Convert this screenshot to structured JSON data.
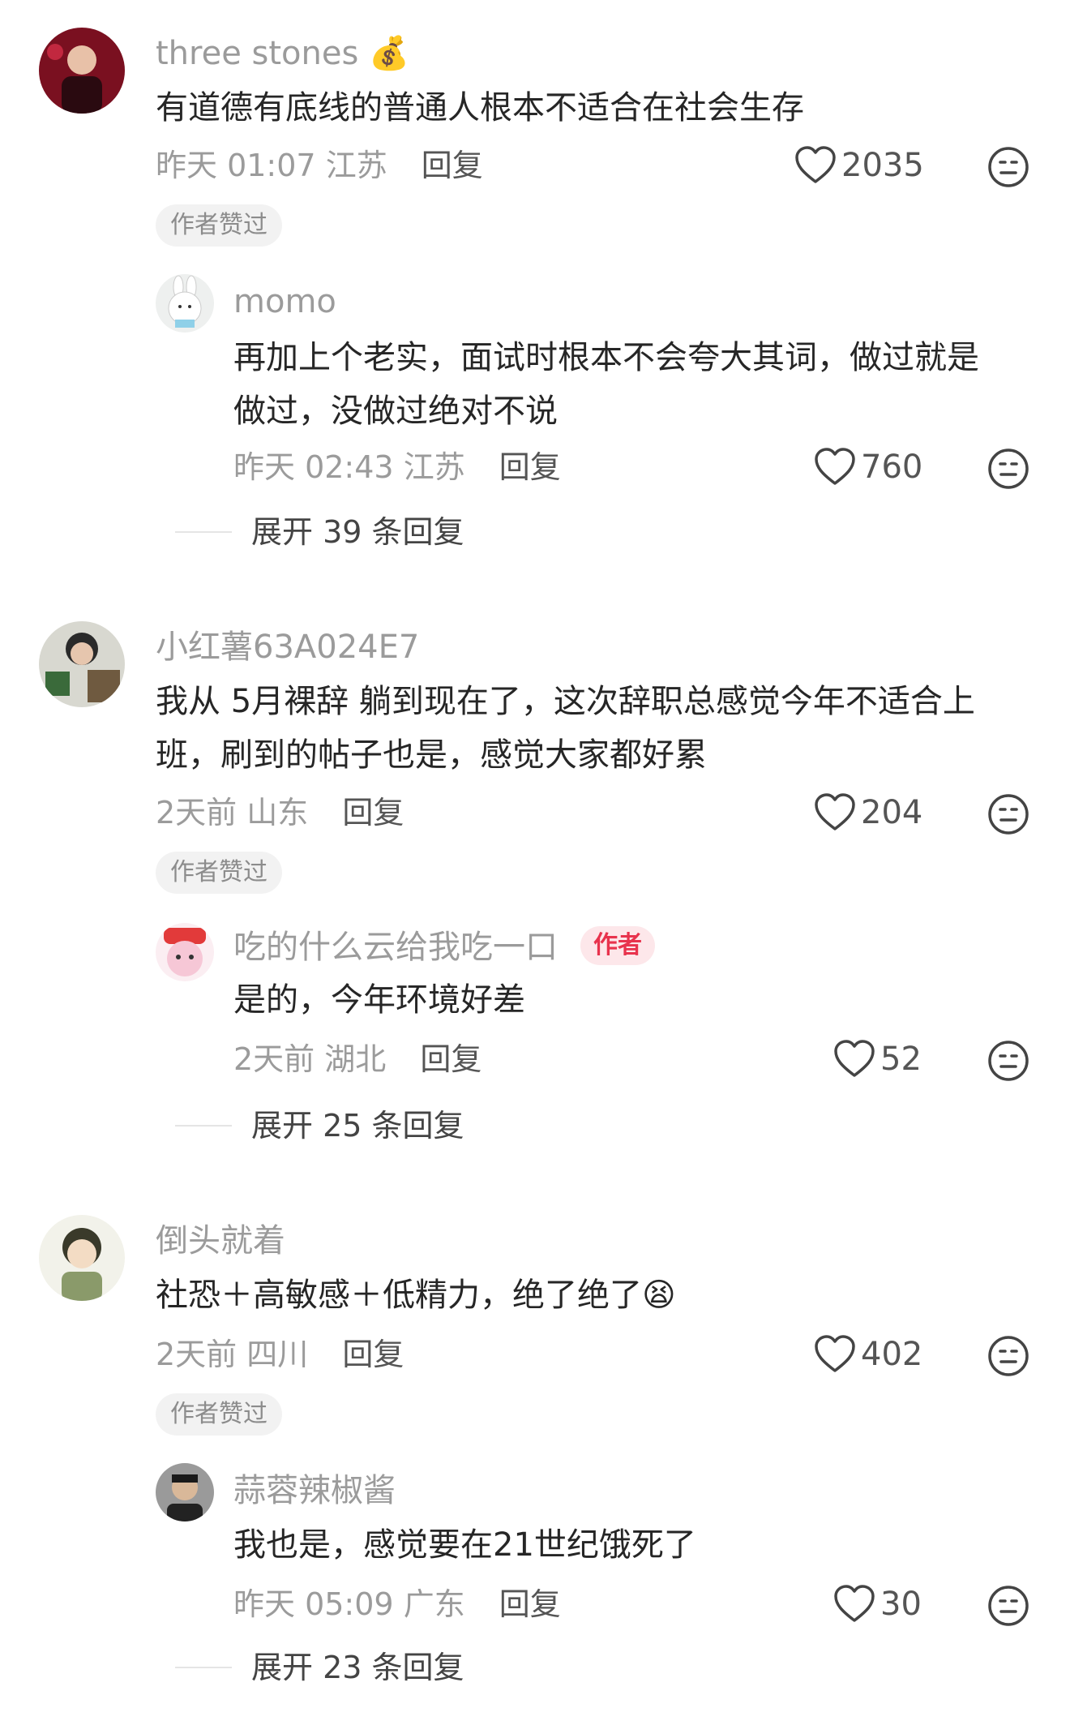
{
  "colors": {
    "author_tag_bg": "#fde7ea",
    "author_tag_text": "#e8334d",
    "muted": "#9b9b9b",
    "text": "#262626"
  },
  "comments": [
    {
      "username": "three stones",
      "username_emoji": "💰",
      "text_lines": [
        "有道德有底线的普通人根本不适合在社会生存"
      ],
      "time": "昨天 01:07",
      "location": "江苏",
      "reply_label": "回复",
      "likes": "2035",
      "badge": "作者赞过",
      "replies": [
        {
          "username": "momo",
          "text_lines": [
            "再加上个老实，面试时根本不会夸大其词，做过就是",
            "做过，没做过绝对不说"
          ],
          "time": "昨天 02:43",
          "location": "江苏",
          "reply_label": "回复",
          "likes": "760"
        }
      ],
      "expand_label": "展开 39 条回复"
    },
    {
      "username": "小红薯63A024E7",
      "text_lines": [
        "我从 5月裸辞 躺到现在了，这次辞职总感觉今年不适合上",
        "班，刷到的帖子也是，感觉大家都好累"
      ],
      "time": "2天前",
      "location": "山东",
      "reply_label": "回复",
      "likes": "204",
      "badge": "作者赞过",
      "replies": [
        {
          "username": "吃的什么云给我吃一口",
          "author_tag": "作者",
          "text_lines": [
            "是的，今年环境好差"
          ],
          "time": "2天前",
          "location": "湖北",
          "reply_label": "回复",
          "likes": "52"
        }
      ],
      "expand_label": "展开 25 条回复"
    },
    {
      "username": "倒头就着",
      "text_lines": [
        "社恐＋高敏感＋低精力，绝了绝了"
      ],
      "text_emoji": "😫",
      "time": "2天前",
      "location": "四川",
      "reply_label": "回复",
      "likes": "402",
      "badge": "作者赞过",
      "replies": [
        {
          "username": "蒜蓉辣椒酱",
          "text_lines": [
            "我也是，感觉要在21世纪饿死了"
          ],
          "time": "昨天 05:09",
          "location": "广东",
          "reply_label": "回复",
          "likes": "30"
        }
      ],
      "expand_label": "展开 23 条回复"
    }
  ]
}
